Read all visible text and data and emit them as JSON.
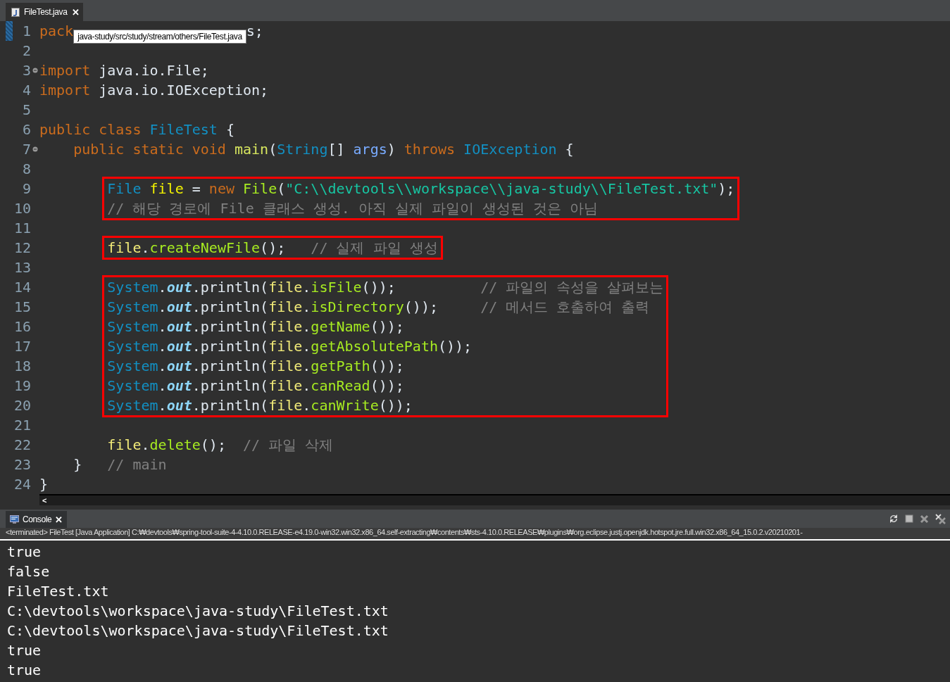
{
  "editor_tab": {
    "label": "FileTest.java",
    "close": "✕",
    "selected": true
  },
  "tooltip": "java-study/src/study/stream/others/FileTest.java",
  "blocks": [
    {
      "kind": "plain",
      "lines": [
        {
          "number": "1",
          "tokens": [
            {
              "kind": "keyword",
              "t": "pack"
            }
          ],
          "after": [
            {
              "kind": "plain",
              "t": "s;"
            }
          ]
        },
        {
          "number": "2"
        },
        {
          "number": "3",
          "fold": true,
          "tokens": [
            {
              "kind": "keyword",
              "t": "import"
            },
            {
              "kind": "plain",
              "t": " java.io.File;"
            }
          ]
        },
        {
          "number": "4",
          "tokens": [
            {
              "kind": "keyword",
              "t": "import"
            },
            {
              "kind": "plain",
              "t": " java.io.IOException;"
            }
          ]
        },
        {
          "number": "5"
        },
        {
          "number": "6",
          "tokens": [
            {
              "kind": "keyword",
              "t": "public class"
            },
            {
              "kind": "type",
              "t": " FileTest"
            },
            {
              "kind": "plain",
              "t": " {"
            }
          ]
        },
        {
          "number": "7",
          "fold": true,
          "tokens": [
            {
              "kind": "keyword",
              "t": "    public static void"
            },
            {
              "kind": "method-decl",
              "t": " main"
            },
            {
              "kind": "plain",
              "t": "("
            },
            {
              "kind": "type",
              "t": "String"
            },
            {
              "kind": "plain",
              "t": "[] "
            },
            {
              "kind": "param",
              "t": "args"
            },
            {
              "kind": "plain",
              "t": ") "
            },
            {
              "kind": "keyword",
              "t": "throws"
            },
            {
              "kind": "type",
              "t": " IOException"
            },
            {
              "kind": "plain",
              "t": " {"
            }
          ]
        },
        {
          "number": "8"
        }
      ]
    },
    {
      "kind": "boxed",
      "lines": [
        {
          "number": "9",
          "tokens": [
            {
              "kind": "type",
              "t": "File"
            },
            {
              "kind": "local",
              "t": " file"
            },
            {
              "kind": "plain",
              "t": " = "
            },
            {
              "kind": "keyword",
              "t": "new"
            },
            {
              "kind": "method",
              "t": " File"
            },
            {
              "kind": "plain",
              "t": "("
            },
            {
              "kind": "string",
              "t": "\"C:\\\\devtools\\\\workspace\\\\java-study\\\\FileTest.txt\""
            },
            {
              "kind": "plain",
              "t": ");"
            }
          ]
        },
        {
          "number": "10",
          "tokens": [
            {
              "kind": "comment",
              "t": "// 해당 경로에 File 클래스 생성. 아직 실제 파일이 생성된 것은 아님"
            }
          ]
        }
      ]
    },
    {
      "kind": "plain",
      "lines": [
        {
          "number": "11"
        }
      ]
    },
    {
      "kind": "boxed",
      "lines": [
        {
          "number": "12",
          "tokens": [
            {
              "kind": "var",
              "t": "file"
            },
            {
              "kind": "plain",
              "t": "."
            },
            {
              "kind": "method",
              "t": "createNewFile"
            },
            {
              "kind": "plain",
              "t": "();   "
            },
            {
              "kind": "comment",
              "t": "// 실제 파일 생성"
            }
          ]
        }
      ]
    },
    {
      "kind": "plain",
      "lines": [
        {
          "number": "13"
        }
      ]
    },
    {
      "kind": "boxed",
      "lines": [
        {
          "number": "14",
          "tokens": [
            {
              "kind": "type",
              "t": "System"
            },
            {
              "kind": "plain",
              "t": "."
            },
            {
              "kind": "static",
              "t": "out"
            },
            {
              "kind": "plain",
              "t": ".println("
            },
            {
              "kind": "var",
              "t": "file"
            },
            {
              "kind": "plain",
              "t": "."
            },
            {
              "kind": "method",
              "t": "isFile"
            },
            {
              "kind": "plain",
              "t": "());          "
            },
            {
              "kind": "comment",
              "t": "// 파일의 속성을 살펴보는"
            }
          ]
        },
        {
          "number": "15",
          "tokens": [
            {
              "kind": "type",
              "t": "System"
            },
            {
              "kind": "plain",
              "t": "."
            },
            {
              "kind": "static",
              "t": "out"
            },
            {
              "kind": "plain",
              "t": ".println("
            },
            {
              "kind": "var",
              "t": "file"
            },
            {
              "kind": "plain",
              "t": "."
            },
            {
              "kind": "method",
              "t": "isDirectory"
            },
            {
              "kind": "plain",
              "t": "());     "
            },
            {
              "kind": "comment",
              "t": "// 메서드 호출하여 출력"
            }
          ]
        },
        {
          "number": "16",
          "tokens": [
            {
              "kind": "type",
              "t": "System"
            },
            {
              "kind": "plain",
              "t": "."
            },
            {
              "kind": "static",
              "t": "out"
            },
            {
              "kind": "plain",
              "t": ".println("
            },
            {
              "kind": "var",
              "t": "file"
            },
            {
              "kind": "plain",
              "t": "."
            },
            {
              "kind": "method",
              "t": "getName"
            },
            {
              "kind": "plain",
              "t": "());"
            }
          ]
        },
        {
          "number": "17",
          "tokens": [
            {
              "kind": "type",
              "t": "System"
            },
            {
              "kind": "plain",
              "t": "."
            },
            {
              "kind": "static",
              "t": "out"
            },
            {
              "kind": "plain",
              "t": ".println("
            },
            {
              "kind": "var",
              "t": "file"
            },
            {
              "kind": "plain",
              "t": "."
            },
            {
              "kind": "method",
              "t": "getAbsolutePath"
            },
            {
              "kind": "plain",
              "t": "());"
            }
          ]
        },
        {
          "number": "18",
          "tokens": [
            {
              "kind": "type",
              "t": "System"
            },
            {
              "kind": "plain",
              "t": "."
            },
            {
              "kind": "static",
              "t": "out"
            },
            {
              "kind": "plain",
              "t": ".println("
            },
            {
              "kind": "var",
              "t": "file"
            },
            {
              "kind": "plain",
              "t": "."
            },
            {
              "kind": "method",
              "t": "getPath"
            },
            {
              "kind": "plain",
              "t": "());"
            }
          ]
        },
        {
          "number": "19",
          "tokens": [
            {
              "kind": "type",
              "t": "System"
            },
            {
              "kind": "plain",
              "t": "."
            },
            {
              "kind": "static",
              "t": "out"
            },
            {
              "kind": "plain",
              "t": ".println("
            },
            {
              "kind": "var",
              "t": "file"
            },
            {
              "kind": "plain",
              "t": "."
            },
            {
              "kind": "method",
              "t": "canRead"
            },
            {
              "kind": "plain",
              "t": "());"
            }
          ]
        },
        {
          "number": "20",
          "tokens": [
            {
              "kind": "type",
              "t": "System"
            },
            {
              "kind": "plain",
              "t": "."
            },
            {
              "kind": "static",
              "t": "out"
            },
            {
              "kind": "plain",
              "t": ".println("
            },
            {
              "kind": "var",
              "t": "file"
            },
            {
              "kind": "plain",
              "t": "."
            },
            {
              "kind": "method",
              "t": "canWrite"
            },
            {
              "kind": "plain",
              "t": "());"
            }
          ]
        }
      ]
    },
    {
      "kind": "plain",
      "lines": [
        {
          "number": "21"
        },
        {
          "number": "22",
          "tokens": [
            {
              "kind": "var",
              "t": "        file"
            },
            {
              "kind": "plain",
              "t": "."
            },
            {
              "kind": "method",
              "t": "delete"
            },
            {
              "kind": "plain",
              "t": "();  "
            },
            {
              "kind": "comment",
              "t": "// 파일 삭제"
            }
          ]
        },
        {
          "number": "23",
          "tokens": [
            {
              "kind": "plain",
              "t": "    }   "
            },
            {
              "kind": "comment",
              "t": "// main"
            }
          ]
        },
        {
          "number": "24",
          "tokens": [
            {
              "kind": "plain",
              "t": "}"
            }
          ]
        }
      ]
    }
  ],
  "scroll_arrow": "<",
  "console": {
    "tab": {
      "label": "Console",
      "close": "✕",
      "selected": true
    },
    "header": "<terminated> FileTest [Java Application] C:₩devtools₩spring-tool-suite-4-4.10.0.RELEASE-e4.19.0-win32.win32.x86_64.self-extracting₩contents₩sts-4.10.0.RELEASE₩plugins₩org.eclipse.justj.openjdk.hotspot.jre.full.win32.x86_64_15.0.2.v20210201-",
    "output": [
      "true",
      "false",
      "FileTest.txt",
      "C:\\devtools\\workspace\\java-study\\FileTest.txt",
      "C:\\devtools\\workspace\\java-study\\FileTest.txt",
      "true",
      "true"
    ]
  }
}
